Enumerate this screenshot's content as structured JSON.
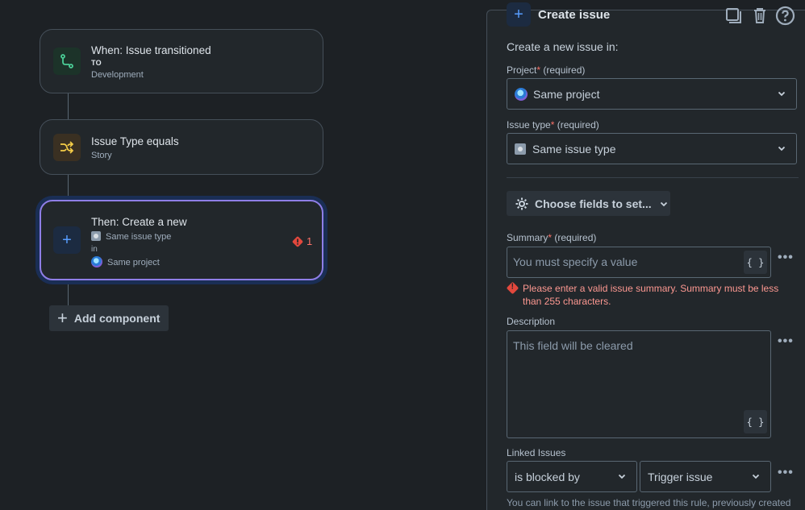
{
  "flow": {
    "trigger": {
      "title": "When: Issue transitioned",
      "to_label": "TO",
      "status": "Development"
    },
    "condition": {
      "title": "Issue Type equals",
      "value": "Story"
    },
    "action": {
      "title": "Then: Create a new",
      "issue_type": "Same issue type",
      "in_label": "in",
      "project": "Same project",
      "error_count": "1"
    },
    "add_component_label": "Add component"
  },
  "panel": {
    "title": "Create issue",
    "intro": "Create a new issue in:",
    "project": {
      "label": "Project",
      "required_star": "*",
      "required_text": "(required)",
      "value": "Same project"
    },
    "issue_type": {
      "label": "Issue type",
      "required_star": "*",
      "required_text": "(required)",
      "value": "Same issue type"
    },
    "choose_fields_label": "Choose fields to set...",
    "summary": {
      "label": "Summary",
      "required_star": "*",
      "required_text": "(required)",
      "placeholder": "You must specify a value",
      "error": "Please enter a valid issue summary. Summary must be less than 255 characters."
    },
    "description": {
      "label": "Description",
      "placeholder": "This field will be cleared"
    },
    "linked_issues": {
      "label": "Linked Issues",
      "relation": "is blocked by",
      "target": "Trigger issue"
    },
    "footer_text": "You can link to the issue that triggered this rule, previously created",
    "braces_label": "{ }"
  },
  "colors": {
    "accent": "#579dff",
    "error": "#f87168",
    "selected_border": "#8f7ee7"
  },
  "icons": [
    "branch-icon",
    "shuffle-icon",
    "plus-icon",
    "error-diamond-icon",
    "copy-icon",
    "trash-icon",
    "help-icon",
    "gear-icon",
    "chevron-down-icon",
    "more-icon"
  ]
}
